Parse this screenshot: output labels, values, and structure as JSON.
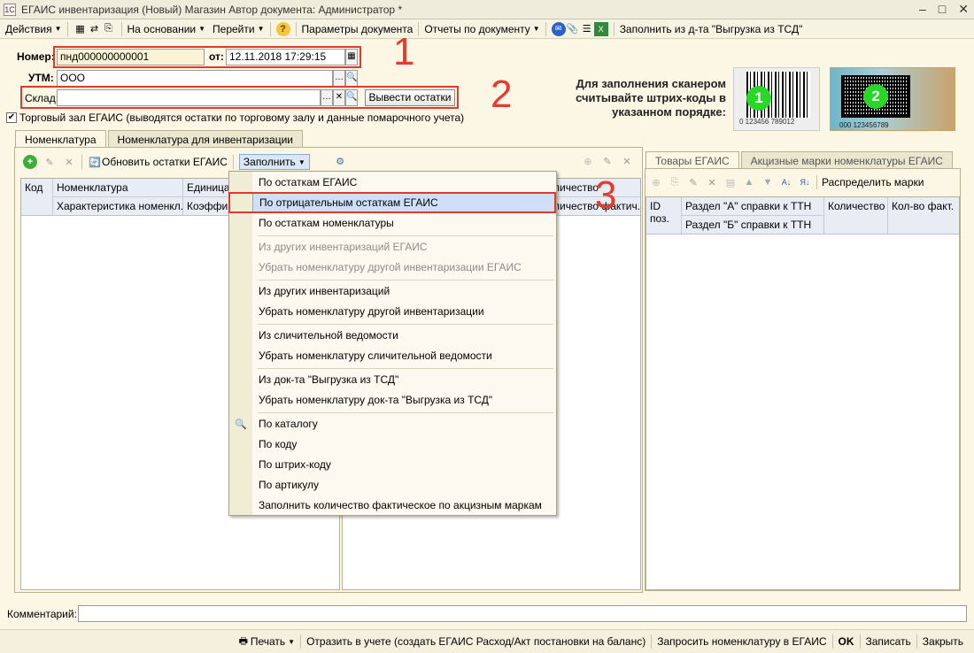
{
  "window": {
    "title": "ЕГАИС инвентаризация (Новый)  Магазин Автор документа: Администратор *"
  },
  "toolbar": {
    "actions": "Действия",
    "based_on": "На основании",
    "goto": "Перейти",
    "params": "Параметры документа",
    "reports": "Отчеты по документу",
    "fill_tsd": "Заполнить из д-та \"Выгрузка из ТСД\""
  },
  "header": {
    "number_label": "Номер:",
    "number_value": "пнд000000000001",
    "date_label": "от:",
    "date_value": "12.11.2018 17:29:15",
    "utm_label": "УТМ:",
    "utm_value": "ООО",
    "warehouse_label": "Склад:",
    "warehouse_value": "",
    "show_stock_button": "Вывести остатки",
    "trade_hall_checkbox": "Торговый зал ЕГАИС (выводятся остатки по торговому залу и данные помарочного учета)",
    "trade_hall_checked": true
  },
  "scanner": {
    "line1": "Для заполнения  сканером",
    "line2": "считывайте штрих-коды в",
    "line3": "указанном порядке:",
    "barcode1_digits": "0 123456 789012",
    "barcode2_digits": "000 123456789",
    "badge1": "1",
    "badge2": "2"
  },
  "annotations": {
    "n1": "1",
    "n2": "2",
    "n3": "3"
  },
  "tabs": {
    "left": [
      "Номенклатура",
      "Номенклатура для инвентаризации"
    ],
    "right": [
      "Товары ЕГАИС",
      "Акцизные марки номенклатуры ЕГАИС"
    ]
  },
  "left_panel": {
    "refresh_button": "Обновить остатки ЕГАИС",
    "fill_button": "Заполнить",
    "columns": {
      "code": "Код",
      "nomenclature": "Номенклатура",
      "unit": "Единица",
      "characteristic": "Характеристика номенкл...",
      "coefficient": "Коэффици"
    }
  },
  "middle_panel": {
    "col_qty": "личество",
    "col_qty_fact": "личество фактич..."
  },
  "right_panel": {
    "distribute_button": "Распределить марки",
    "columns": {
      "id": "ID поз.",
      "section_a": "Раздел \"А\" справки к ТТН",
      "section_b": "Раздел \"Б\" справки к ТТН",
      "qty": "Количество",
      "qty_fact": "Кол-во факт."
    }
  },
  "fill_menu": {
    "items": [
      "По остаткам ЕГАИС",
      "По отрицательным остаткам ЕГАИС",
      "По остаткам номенклатуры",
      "Из других инвентаризаций ЕГАИС",
      "Убрать номенклатуру другой инвентаризации ЕГАИС",
      "Из других инвентаризаций",
      "Убрать номенклатуру другой инвентаризации",
      "Из сличительной ведомости",
      "Убрать номенклатуру сличительной ведомости",
      "Из док-та \"Выгрузка из ТСД\"",
      "Убрать номенклатуру док-та \"Выгрузка из ТСД\"",
      "По каталогу",
      "По коду",
      "По штрих-коду",
      "По артикулу",
      "Заполнить количество фактическое по акцизным маркам"
    ]
  },
  "comment": {
    "label": "Комментарий:",
    "value": ""
  },
  "bottom": {
    "print": "Печать",
    "reflect": "Отразить в учете (создать ЕГАИС Расход/Акт постановки на баланс)",
    "request": "Запросить номенклатуру в ЕГАИС",
    "ok": "OK",
    "save": "Записать",
    "close": "Закрыть"
  }
}
